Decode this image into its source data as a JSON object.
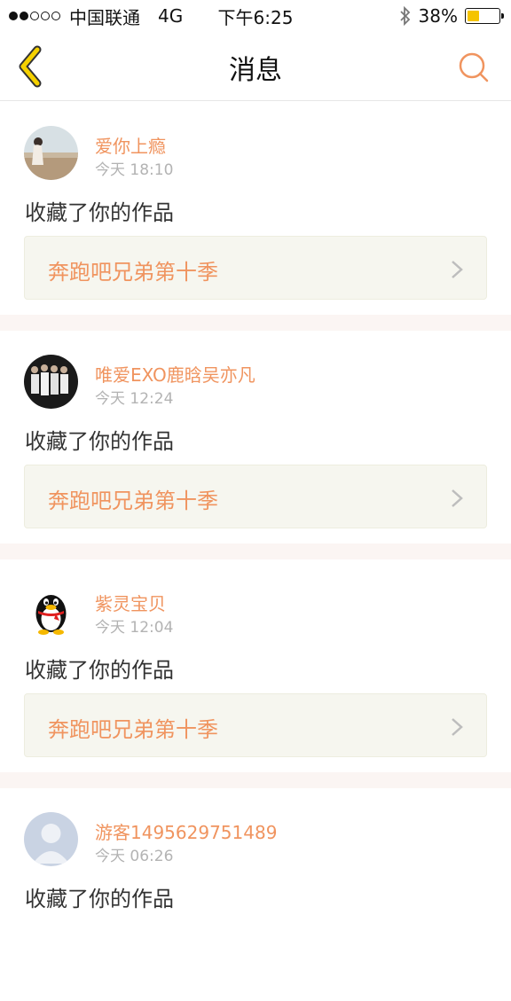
{
  "status_bar": {
    "carrier": "中国联通",
    "network": "4G",
    "time": "下午6:25",
    "battery": "38%",
    "battery_level": 0.38
  },
  "nav": {
    "title": "消息",
    "back_icon": "chevron-left-icon",
    "search_icon": "search-icon"
  },
  "colors": {
    "accent": "#f0945f",
    "back": "#f5c400",
    "divider": "#fbf5f3"
  },
  "messages": [
    {
      "user": "爱你上瘾",
      "time": "今天 18:10",
      "action": "收藏了你的作品",
      "work": "奔跑吧兄弟第十季",
      "avatar": "photo-avatar"
    },
    {
      "user": "唯爱EXO鹿晗吴亦凡",
      "time": "今天 12:24",
      "action": "收藏了你的作品",
      "work": "奔跑吧兄弟第十季",
      "avatar": "group-photo-avatar"
    },
    {
      "user": "紫灵宝贝",
      "time": "今天 12:04",
      "action": "收藏了你的作品",
      "work": "奔跑吧兄弟第十季",
      "avatar": "penguin-avatar"
    },
    {
      "user": "游客1495629751489",
      "time": "今天 06:26",
      "action": "收藏了你的作品",
      "avatar": "default-user-avatar"
    }
  ]
}
